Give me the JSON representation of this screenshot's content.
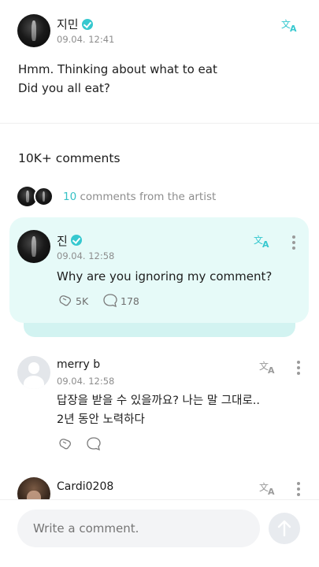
{
  "post": {
    "author": "지민",
    "timestamp": "09.04. 12:41",
    "lines": [
      "Hmm. Thinking about what to eat",
      "Did you all eat?"
    ]
  },
  "comments_header": "10K+ comments",
  "artist_comments": {
    "count": "10",
    "label": "comments from the artist"
  },
  "comments": [
    {
      "author": "진",
      "timestamp": "09.04. 12:58",
      "text_lines": [
        "Why are you ignoring my comment?"
      ],
      "likes": "5K",
      "replies": "178",
      "verified": true,
      "highlighted": true
    },
    {
      "author": "merry b",
      "timestamp": "09.04. 12:58",
      "text_lines": [
        "답장을 받을 수 있을까요? 나는 말 그대로..",
        "2년 동안 노력하다"
      ]
    },
    {
      "author": "Cardi0208"
    }
  ],
  "composer": {
    "placeholder": "Write a comment."
  },
  "colors": {
    "accent": "#36c8cf",
    "highlight_bg": "#e6faf8"
  },
  "icons": [
    "translate-icon",
    "more-icon",
    "verified-icon",
    "like-icon",
    "reply-icon",
    "send-icon"
  ]
}
